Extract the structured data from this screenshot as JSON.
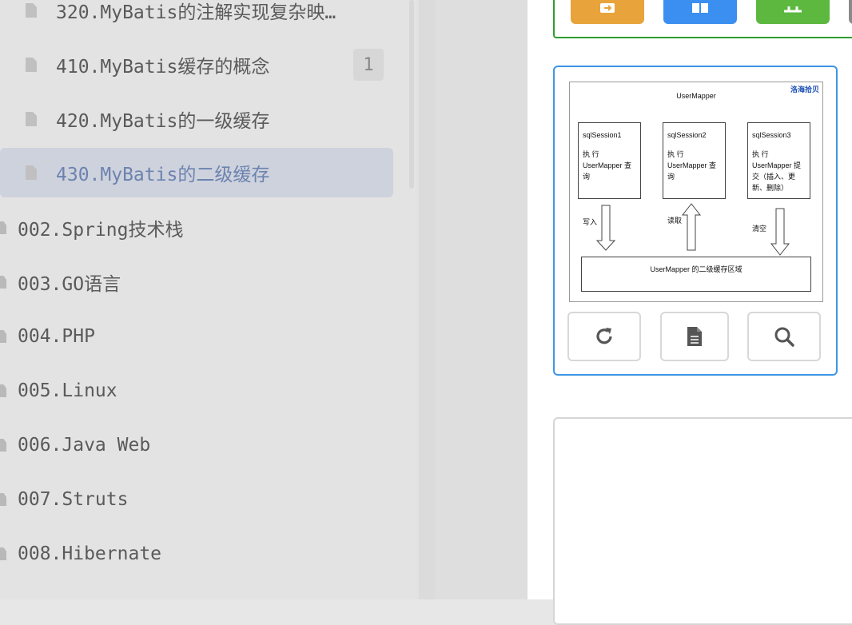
{
  "sidebar": {
    "items": [
      {
        "label": "320.MyBatis的注解实现复杂映…",
        "type": "doc"
      },
      {
        "label": "410.MyBatis缓存的概念",
        "type": "doc",
        "badge": "1"
      },
      {
        "label": "420.MyBatis的一级缓存",
        "type": "doc"
      },
      {
        "label": "430.MyBatis的二级缓存",
        "type": "doc",
        "active": true
      },
      {
        "label": "002.Spring技术栈",
        "type": "folder"
      },
      {
        "label": "003.GO语言",
        "type": "folder"
      },
      {
        "label": "004.PHP",
        "type": "folder"
      },
      {
        "label": "005.Linux",
        "type": "folder"
      },
      {
        "label": "006.Java Web",
        "type": "folder"
      },
      {
        "label": "007.Struts",
        "type": "folder"
      },
      {
        "label": "008.Hibernate",
        "type": "folder"
      }
    ]
  },
  "panel": {
    "top_buttons": [
      {
        "icon": "export-icon",
        "color": "#e8a33a"
      },
      {
        "icon": "copy-icon",
        "color": "#3b8ff1"
      },
      {
        "icon": "share-icon",
        "color": "#5cb83f"
      }
    ],
    "diagram": {
      "title": "UserMapper",
      "logo": "洛海拾贝",
      "sessions": [
        {
          "name": "sqlSession1",
          "text": "执 行  UserMapper 查询"
        },
        {
          "name": "sqlSession2",
          "text": "执 行  UserMapper 查询"
        },
        {
          "name": "sqlSession3",
          "text": "执 行  UserMapper 提交（插入、更新、删除）"
        }
      ],
      "arrows": [
        {
          "label": "写入",
          "direction": "down"
        },
        {
          "label": "读取",
          "direction": "up"
        },
        {
          "label": "清空",
          "direction": "down"
        }
      ],
      "cache_area": "UserMapper 的二级缓存区域"
    },
    "actions": [
      {
        "icon": "refresh-icon"
      },
      {
        "icon": "document-icon"
      },
      {
        "icon": "search-icon"
      }
    ],
    "colors": {
      "accent_blue": "#3d95e6",
      "border_green": "#2e9e2e",
      "active_text": "#6f86b3"
    }
  }
}
